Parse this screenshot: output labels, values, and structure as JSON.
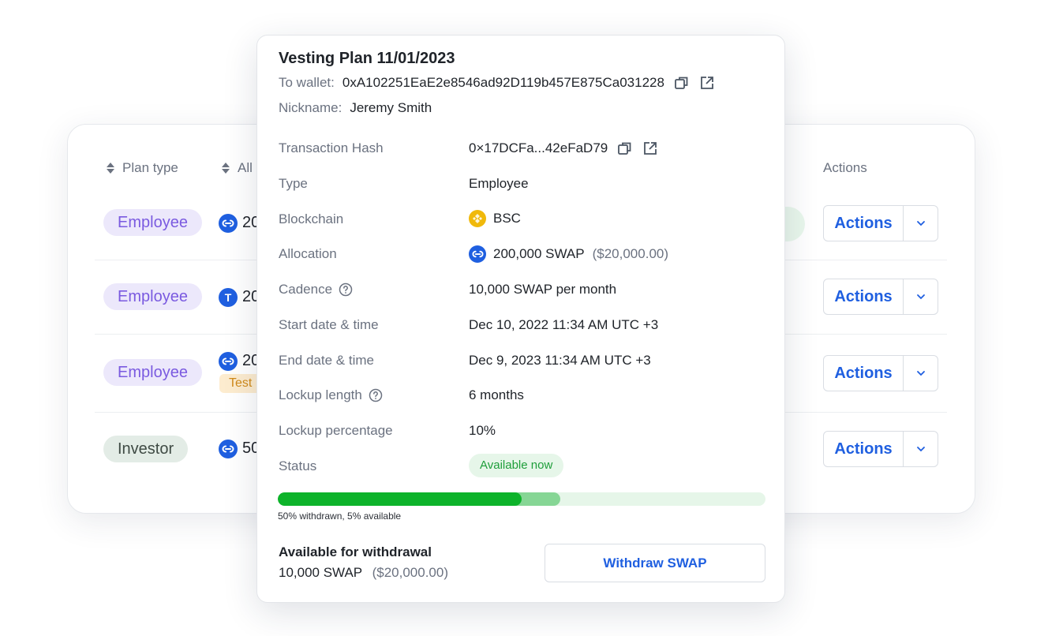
{
  "table": {
    "headers": {
      "plan_type": "Plan type",
      "allocation_partial": "All",
      "actions": "Actions"
    },
    "rows": [
      {
        "plan_type": "Employee",
        "token_icon": "swap-icon",
        "amount_partial": "20",
        "actions_label": "Actions"
      },
      {
        "plan_type": "Employee",
        "token_icon": "tether-icon",
        "token_glyph": "T",
        "amount_partial": "20",
        "actions_label": "Actions"
      },
      {
        "plan_type": "Employee",
        "token_icon": "swap-icon",
        "amount_partial": "20",
        "badge_partial": "Test",
        "actions_label": "Actions"
      },
      {
        "plan_type": "Investor",
        "token_icon": "swap-icon",
        "amount_partial": "50",
        "actions_label": "Actions"
      }
    ]
  },
  "panel": {
    "title": "Vesting Plan 11/01/2023",
    "to_wallet_label": "To wallet:",
    "to_wallet_value": "0xA102251EaE2e8546ad92D119b457E875Ca031228",
    "nickname_label": "Nickname:",
    "nickname_value": "Jeremy Smith",
    "details": {
      "tx_hash": {
        "label": "Transaction Hash",
        "value": "0×17DCFa...42eFaD79"
      },
      "type": {
        "label": "Type",
        "value": "Employee"
      },
      "blockchain": {
        "label": "Blockchain",
        "value": "BSC",
        "icon": "bnb-icon"
      },
      "allocation": {
        "label": "Allocation",
        "value": "200,000 SWAP",
        "usd": "($20,000.00)",
        "icon": "swap-icon"
      },
      "cadence": {
        "label": "Cadence",
        "value": "10,000 SWAP per month"
      },
      "start": {
        "label": "Start date & time",
        "value": "Dec 10, 2022 11:34 AM UTC +3"
      },
      "end": {
        "label": "End date & time",
        "value": "Dec 9, 2023 11:34 AM UTC +3"
      },
      "lockup_length": {
        "label": "Lockup length",
        "value": "6 months"
      },
      "lockup_percentage": {
        "label": "Lockup percentage",
        "value": "10%"
      },
      "status": {
        "label": "Status",
        "value": "Available now"
      }
    },
    "progress": {
      "withdrawn_percent": 50,
      "available_percent": 5,
      "caption": "50% withdrawn, 5% available"
    },
    "available": {
      "title": "Available for withdrawal",
      "amount": "10,000 SWAP",
      "usd": "($20,000.00)"
    },
    "withdraw_button": "Withdraw SWAP"
  },
  "colors": {
    "accent_blue": "#1f5fe0",
    "employee_pill_bg": "#ece8fb",
    "employee_pill_text": "#7a5ae0",
    "investor_pill_bg": "#e3ece6",
    "status_green": "#1e9e3a",
    "progress_withdrawn": "#0db32a",
    "progress_available": "#86d695",
    "progress_track": "#e6f6e9",
    "test_badge_bg": "#fdeccf",
    "bnb_yellow": "#f0b90b"
  }
}
